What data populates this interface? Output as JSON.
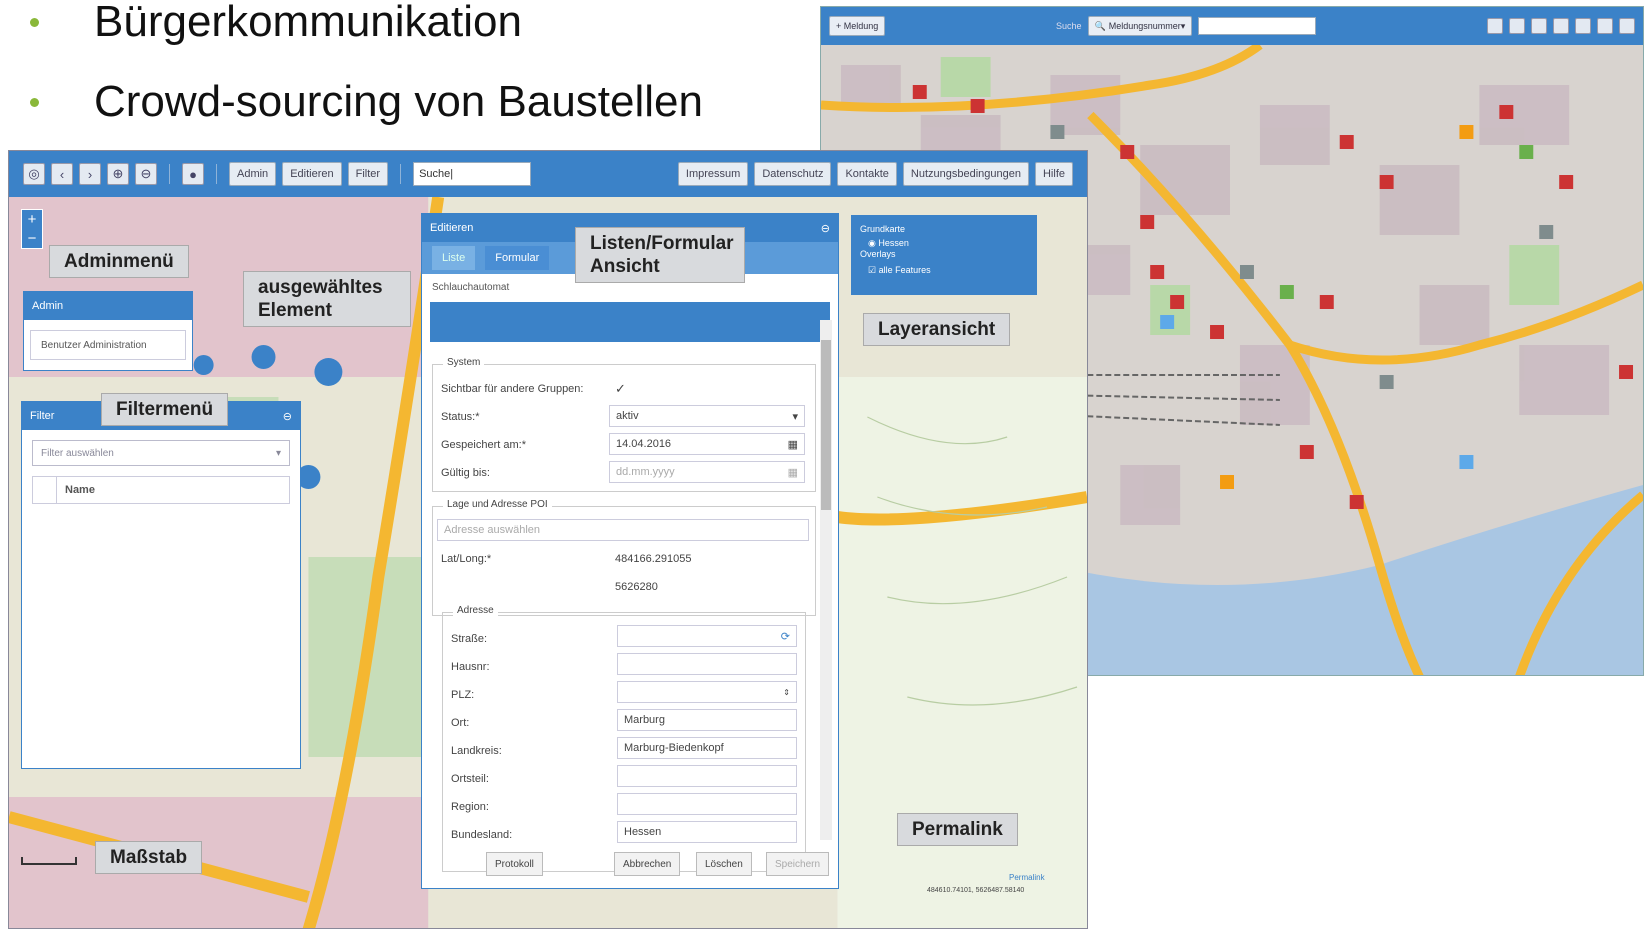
{
  "slide": {
    "bullets": [
      "Bürgerkommunikation",
      "Crowd-sourcing von Baustellen"
    ]
  },
  "right_shot": {
    "new_button": "+ Meldung",
    "search_label": "Suche",
    "search_select": "Meldungsnummer",
    "search_value": ""
  },
  "left_shot": {
    "toolbar": {
      "dot": "●",
      "admin": "Admin",
      "edit": "Editieren",
      "filter": "Filter",
      "search": "Suche|",
      "impressum": "Impressum",
      "privacy": "Datenschutz",
      "contact": "Kontakte",
      "terms": "Nutzungsbedingungen",
      "help": "Hilfe"
    },
    "callouts": {
      "admin_menu": "Adminmenü",
      "selected_element": "ausgewähltes Element",
      "filter_menu": "Filtermenü",
      "list_form": "Listen/Formular Ansicht",
      "layer_view": "Layeransicht",
      "permalink": "Permalink",
      "scale": "Maßstab"
    },
    "admin_panel": {
      "title": "Admin",
      "item": "Benutzer Administration"
    },
    "filter_panel": {
      "title": "Filter",
      "select_placeholder": "Filter auswählen",
      "column": "Name"
    },
    "layer_panel": {
      "base": "Grundkarte",
      "hessen": "Hessen",
      "overlays": "Overlays",
      "all_features": "alle Features"
    },
    "edit_panel": {
      "title": "Editieren",
      "tab_list": "Liste",
      "tab_form": "Formular",
      "crumb": "Schlauchautomat",
      "system_legend": "System",
      "visible_label": "Sichtbar für andere Gruppen:",
      "status_label": "Status:*",
      "status_value": "aktiv",
      "saved_label": "Gespeichert am:*",
      "saved_value": "14.04.2016",
      "valid_label": "Gültig bis:",
      "valid_placeholder": "dd.mm.yyyy",
      "poi_legend": "Lage und Adresse POI",
      "address_placeholder": "Adresse auswählen",
      "latlong_label": "Lat/Long:*",
      "lat_value": "484166.291055",
      "long_value": "5626280",
      "address_legend": "Adresse",
      "street": "Straße:",
      "houseno": "Hausnr:",
      "zip": "PLZ:",
      "city": "Ort:",
      "city_value": "Marburg",
      "district": "Landkreis:",
      "district_value": "Marburg-Biedenkopf",
      "quarter": "Ortsteil:",
      "region": "Region:",
      "state": "Bundesland:",
      "state_value": "Hessen",
      "btn_log": "Protokoll",
      "btn_cancel": "Abbrechen",
      "btn_delete": "Löschen",
      "btn_save": "Speichern"
    },
    "permalink_small": "Permalink",
    "coords": "484610.74101, 5626487.58140"
  },
  "colors": {
    "toolbar_blue": "#3b82c8",
    "road_yellow": "#f4b731",
    "marker_red": "#cc3333",
    "accent_green": "#8ab83a"
  }
}
